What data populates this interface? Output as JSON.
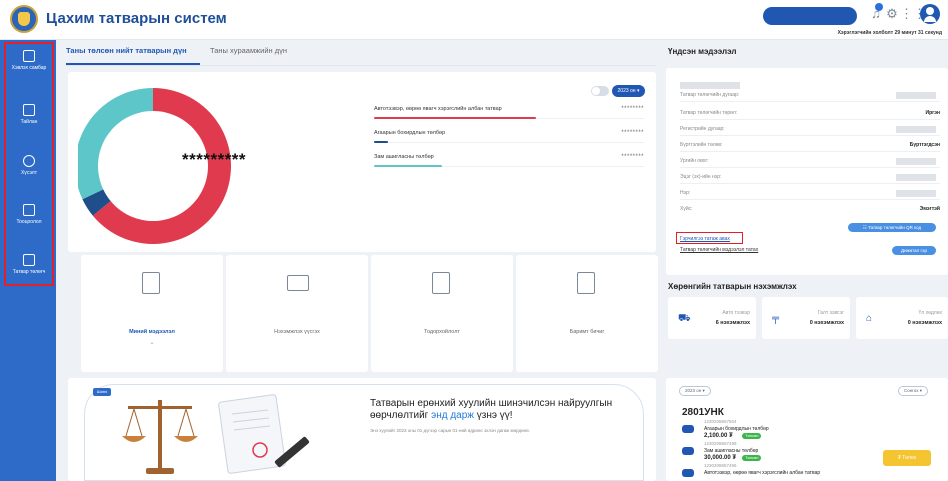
{
  "header": {
    "title": "Цахим татварын систем",
    "session_text": "Хэрэглэгчийн холболт 29 минут 31 секунд"
  },
  "sidebar": {
    "items": [
      {
        "label": "Хэвлэх самбар"
      },
      {
        "label": "Тайлан"
      },
      {
        "label": "Хүсэлт"
      },
      {
        "label": "Тооцоолол"
      },
      {
        "label": "Татвар төлөгч"
      }
    ]
  },
  "tabs": [
    "Таны төлсөн нийт татварын дүн",
    "Таны хураамжийн дүн"
  ],
  "donut": {
    "hidden_total": "*********",
    "year_label": "2023 он ▾",
    "segments": [
      {
        "name": "Автотээвэр, өөрөө явагч хэрэгслийн албан татвар",
        "share": 0.64,
        "color": "#e03a4e"
      },
      {
        "name": "Агаарын бохирдлын төлбөр",
        "share": 0.04,
        "color": "#1f4f8a"
      },
      {
        "name": "Зам ашигласны төлбөр",
        "share": 0.32,
        "color": "#5cc6c9"
      }
    ],
    "rows": [
      {
        "name": "Автотээвэр, өөрөө явагч хэрэгслийн албан татвар",
        "amount": "********",
        "color": "#e03a4e",
        "fill": 0.6
      },
      {
        "name": "Агаарын бохирдлын төлбөр",
        "amount": "********",
        "color": "#1f4f8a",
        "fill": 0.05
      },
      {
        "name": "Зам ашигласны төлбөр",
        "amount": "********",
        "color": "#5cc6c9",
        "fill": 0.25
      }
    ]
  },
  "quick_actions": [
    {
      "label": "Миний мэдээлэл",
      "chevron": "⌄",
      "icon": "document-icon",
      "active": true
    },
    {
      "label": "Нэхэмжлэх үүсгэх",
      "icon": "card-icon",
      "active": false
    },
    {
      "label": "Тодорхойлолт",
      "icon": "qr-icon",
      "active": false
    },
    {
      "label": "Баримт бичиг",
      "icon": "file-icon",
      "active": false
    }
  ],
  "banner": {
    "badge": "Шинэ",
    "title_part1": "Татварын ерөнхий хуулийн шинэчилсэн найруулгын өөрчлөлтийг ",
    "title_link": "энд дарж",
    "title_part2": " үзнэ үү!",
    "subtitle": "Энэ хуулийг 2023 оны 01 дүгээр сарын 01-ний өдрөөс эхлэн дагаж мөрдөнө."
  },
  "right": {
    "info_title": "Үндсэн мэдээлэл",
    "rows": [
      {
        "key": "Татвар төлөгчийн дугаар:",
        "value": ""
      },
      {
        "key": "Татвар төлөгчийн төрөл:",
        "value": "Иргэн"
      },
      {
        "key": "Регистрийн дугаар:",
        "value": ""
      },
      {
        "key": "Бүртгэлийн төлөв:",
        "value": "Бүртгэгдсэн"
      },
      {
        "key": "Ургийн овог:",
        "value": ""
      },
      {
        "key": "Эцэг (эх)-ийн нэр:",
        "value": ""
      },
      {
        "key": "Нэр:",
        "value": ""
      },
      {
        "key": "Хүйс:",
        "value": "Эмэгтэй"
      }
    ],
    "qr_button": "☷ Татвар төлөгчийн QR код",
    "download_link": "Гэрчилгээ татаж авах",
    "tax_info_link": "Татвар төлөгчийн мэдээлэл татах",
    "digital_button": "Дижитал гэр",
    "property_title": "Хөрөнгийн татварын нэхэмжлэх",
    "properties": [
      {
        "name": "Авто тээвэр",
        "count": "6 нэхэмжлэх",
        "icon": "car-icon"
      },
      {
        "name": "Галт зэвсэг",
        "count": "0 нэхэмжлэх",
        "icon": "gun-icon"
      },
      {
        "name": "Үл хөдлөх",
        "count": "0 нэхэмжлэх",
        "icon": "house-icon"
      }
    ],
    "year_pill": "2023 он ▾",
    "sort_pill": "Сонгох ▾",
    "plate": "2801УНК",
    "payments": [
      {
        "number": "1230208657504",
        "name": "Агаарын бохирдлын төлбөр",
        "amount": "2,100.00 ₮",
        "status": "Төлсөн"
      },
      {
        "number": "1230208657499",
        "name": "Зам ашигласны төлбөр",
        "amount": "30,000.00 ₮",
        "status": "Төлсөн"
      },
      {
        "number": "1230208657496",
        "name": "Автотээвэр, өөрөө явагч хэрэгслийн албан татвар",
        "amount": "",
        "status": ""
      }
    ],
    "pay_button": "₮ Төлөх"
  }
}
